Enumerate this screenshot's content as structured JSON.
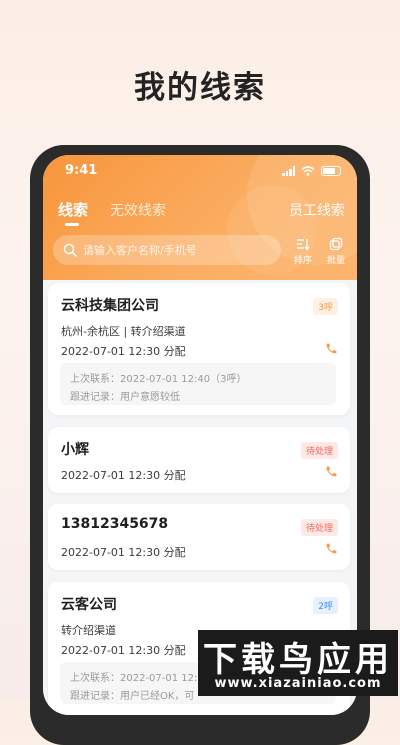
{
  "page": {
    "title": "我的线索"
  },
  "status_bar": {
    "time": "9:41"
  },
  "tabs": {
    "active": "线索",
    "inactive": "无效线索",
    "right": "员工线索"
  },
  "search": {
    "placeholder": "请输入客户名称/手机号"
  },
  "tools": {
    "sort_label": "排序",
    "batch_label": "批量"
  },
  "colors": {
    "accent": "#f8953c",
    "badge_orange": "#f39a45",
    "badge_red": "#f06a5a",
    "badge_blue": "#3a8bf0"
  },
  "cards": [
    {
      "title": "云科技集团公司",
      "badge": "3呼",
      "line1": "杭州-余杭区 | 转介绍渠道",
      "line2": "2022-07-01 12:30 分配",
      "record_line1": "上次联系：2022-07-01 12:40（3呼）",
      "record_line2": "跟进记录：用户意愿较低"
    },
    {
      "title": "小辉",
      "badge": "待处理",
      "line1": "2022-07-01 12:30 分配"
    },
    {
      "title": "13812345678",
      "badge": "待处理",
      "line1": "2022-07-01 12:30 分配"
    },
    {
      "title": "云客公司",
      "badge": "2呼",
      "line1": "转介绍渠道",
      "line2": "2022-07-01 12:30 分配",
      "record_line1": "上次联系：2022-07-01 12:30",
      "record_line2": "跟进记录：用户已经OK，可"
    }
  ],
  "watermark": {
    "text": "下载鸟应用",
    "url": "www.xiazainiao.com"
  }
}
